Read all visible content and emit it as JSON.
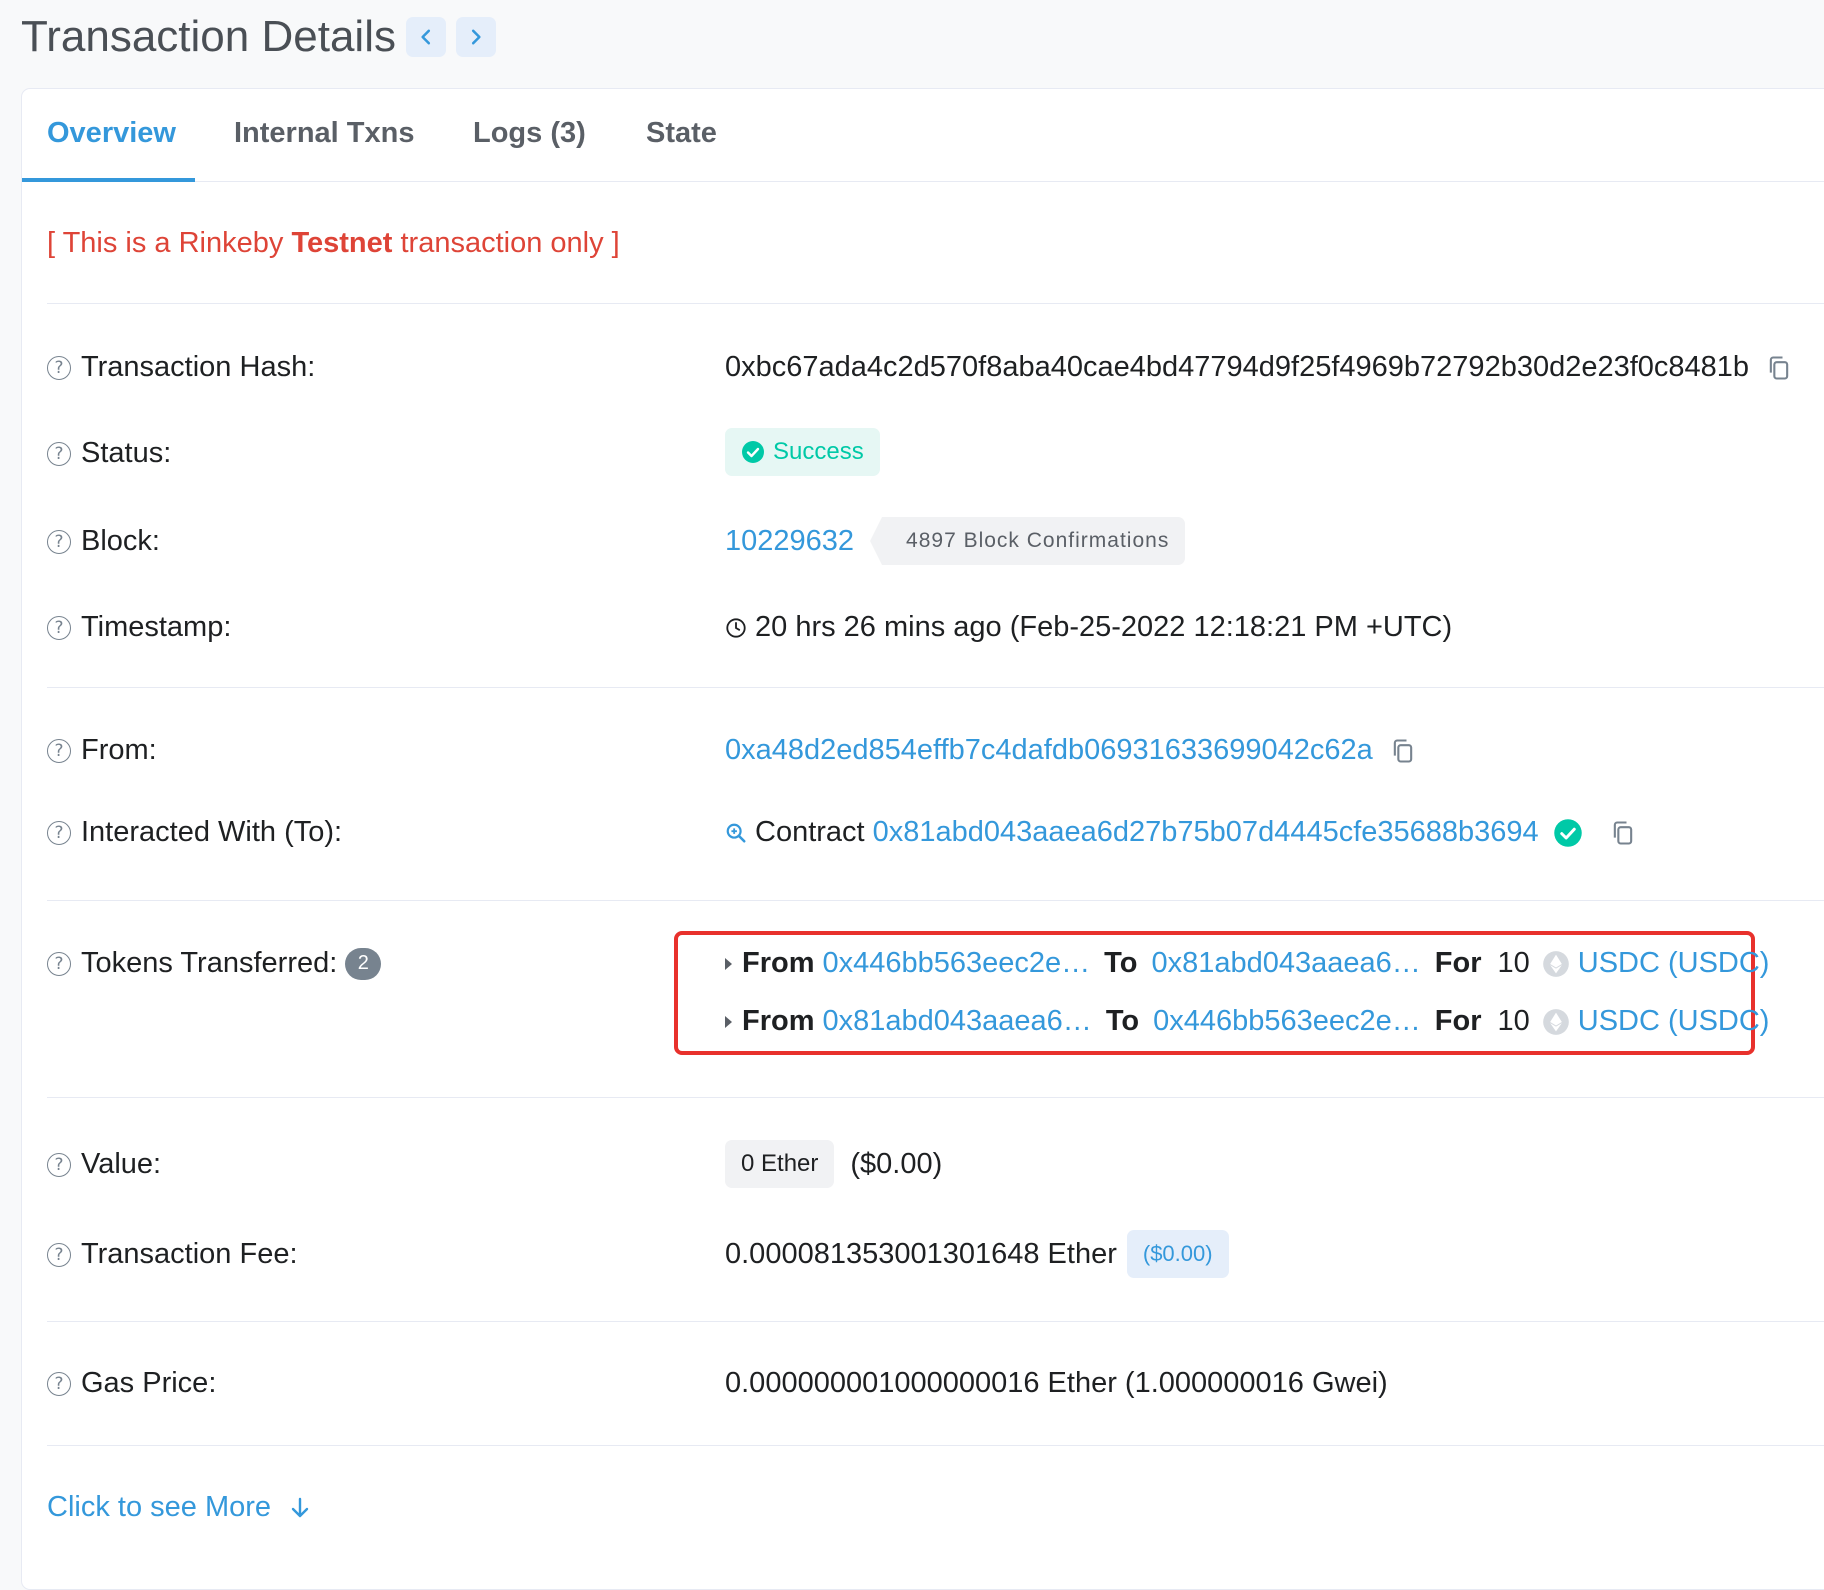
{
  "page": {
    "title": "Transaction Details"
  },
  "tabs": [
    {
      "label": "Overview",
      "active": true
    },
    {
      "label": "Internal Txns",
      "active": false
    },
    {
      "label": "Logs (3)",
      "active": false
    },
    {
      "label": "State",
      "active": false
    }
  ],
  "notice": {
    "prefix": "[ This is a Rinkeby ",
    "bold": "Testnet",
    "suffix": " transaction only ]"
  },
  "fields": {
    "hash": {
      "label": "Transaction Hash:",
      "value": "0xbc67ada4c2d570f8aba40cae4bd47794d9f25f4969b72792b30d2e23f0c8481b"
    },
    "status": {
      "label": "Status:",
      "value": "Success"
    },
    "block": {
      "label": "Block:",
      "value": "10229632",
      "confirmations": "4897 Block Confirmations"
    },
    "timestamp": {
      "label": "Timestamp:",
      "value": "20 hrs 26 mins ago (Feb-25-2022 12:18:21 PM +UTC)"
    },
    "from": {
      "label": "From:",
      "value": "0xa48d2ed854effb7c4dafdb06931633699042c62a"
    },
    "to": {
      "label": "Interacted With (To):",
      "prefix": "Contract",
      "value": "0x81abd043aaea6d27b75b07d4445cfe35688b3694"
    },
    "tokens": {
      "label": "Tokens Transferred:",
      "count": "2",
      "transfers": [
        {
          "from_label": "From",
          "from": "0x446bb563eec2e…",
          "to_label": "To",
          "to": "0x81abd043aaea6…",
          "for_label": "For",
          "amount": "10",
          "token": "USDC (USDC)"
        },
        {
          "from_label": "From",
          "from": "0x81abd043aaea6…",
          "to_label": "To",
          "to": "0x446bb563eec2e…",
          "for_label": "For",
          "amount": "10",
          "token": "USDC (USDC)"
        }
      ]
    },
    "value": {
      "label": "Value:",
      "value": "0 Ether",
      "usd": "($0.00)"
    },
    "fee": {
      "label": "Transaction Fee:",
      "value": "0.000081353001301648 Ether",
      "usd": "($0.00)"
    },
    "gas": {
      "label": "Gas Price:",
      "value": "0.000000001000000016 Ether (1.000000016 Gwei)"
    }
  },
  "more": {
    "label": "Click to see More"
  },
  "colors": {
    "accent": "#3498db",
    "success": "#00c9a7",
    "danger": "#de4437",
    "highlight_box": "#e8312c"
  },
  "icons": [
    "chevron-left-icon",
    "chevron-right-icon",
    "help-circle-icon",
    "copy-icon",
    "check-circle-icon",
    "clock-icon",
    "search-contract-icon",
    "verified-icon",
    "eth-coin-icon",
    "arrow-down-icon",
    "caret-right-icon"
  ]
}
